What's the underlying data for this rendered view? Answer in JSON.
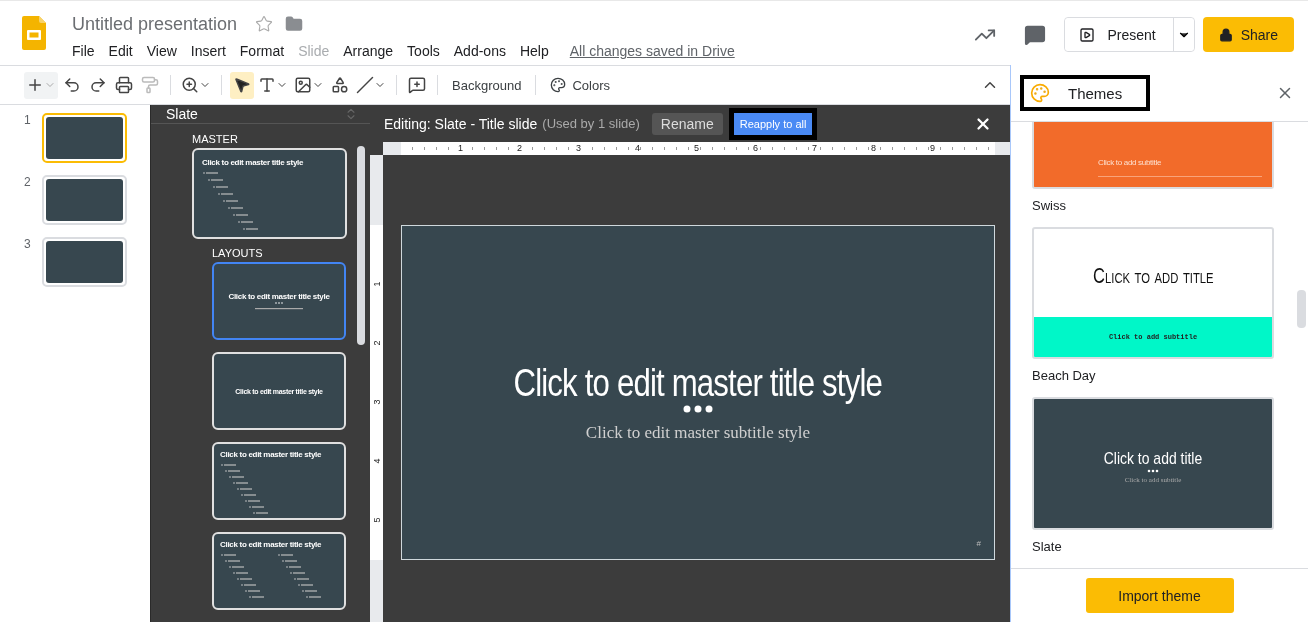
{
  "app": {
    "title": "Untitled presentation",
    "save_status": "All changes saved in Drive",
    "menu": [
      {
        "label": "File",
        "disabled": false
      },
      {
        "label": "Edit",
        "disabled": false
      },
      {
        "label": "View",
        "disabled": false
      },
      {
        "label": "Insert",
        "disabled": false
      },
      {
        "label": "Format",
        "disabled": false
      },
      {
        "label": "Slide",
        "disabled": true
      },
      {
        "label": "Arrange",
        "disabled": false
      },
      {
        "label": "Tools",
        "disabled": false
      },
      {
        "label": "Add-ons",
        "disabled": false
      },
      {
        "label": "Help",
        "disabled": false
      }
    ],
    "present": "Present",
    "share": "Share"
  },
  "toolbar": {
    "pointer_active": true,
    "background": "Background",
    "colors": "Colors"
  },
  "filmstrip": [
    {
      "number": "1",
      "selected": true
    },
    {
      "number": "2",
      "selected": false
    },
    {
      "number": "3",
      "selected": false
    }
  ],
  "master_panel": {
    "theme": "Slate",
    "master_heading": "MASTER",
    "master_title": "Click to edit master title style",
    "layouts_heading": "LAYOUTS",
    "layouts": [
      {
        "kind": "title",
        "title": "Click to edit master title style",
        "selected": true
      },
      {
        "kind": "title_only",
        "title": "Click to edit master title style",
        "selected": false
      },
      {
        "kind": "bullets",
        "title": "Click to edit master title style",
        "selected": false
      },
      {
        "kind": "two_columns",
        "title": "Click to edit master title style",
        "selected": false
      }
    ]
  },
  "editor": {
    "editing": "Editing: Slate - Title slide",
    "usage": "(Used by 1 slide)",
    "rename": "Rename",
    "reapply": {
      "label": "Reapply to all",
      "outlined": true
    },
    "ruler": [
      "1",
      "2",
      "3",
      "4",
      "5",
      "6",
      "7",
      "8",
      "9"
    ],
    "vertical_ruler": [
      "1",
      "2",
      "3",
      "4",
      "5"
    ],
    "slide": {
      "title": "Click to edit master title style",
      "subtitle": "Click to edit master subtitle style",
      "page_number": "#"
    }
  },
  "themes": {
    "title": "Themes",
    "outlined": true,
    "import": "Import theme",
    "items": [
      {
        "kind": "swiss",
        "name": "Swiss",
        "subtitle": "Click to add subtitle"
      },
      {
        "kind": "beach",
        "name": "Beach Day",
        "title": "Click to add title",
        "subtitle": "Click to add subtitle"
      },
      {
        "kind": "slate",
        "name": "Slate",
        "title": "Click to add title",
        "subtitle": "Click to add subtitle"
      }
    ]
  }
}
